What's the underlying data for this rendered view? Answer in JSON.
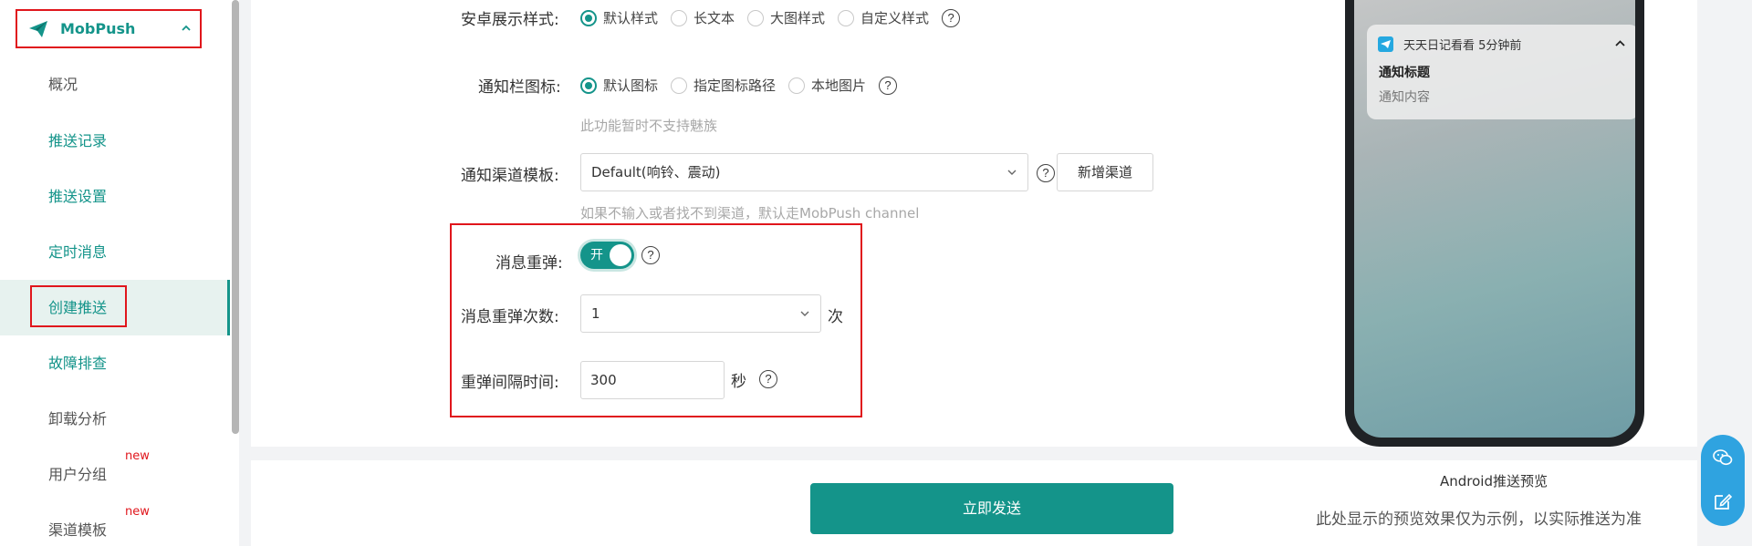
{
  "sidebar": {
    "brand": "MobPush",
    "items": [
      {
        "label": "概况",
        "badge": ""
      },
      {
        "label": "推送记录",
        "badge": ""
      },
      {
        "label": "推送设置",
        "badge": ""
      },
      {
        "label": "定时消息",
        "badge": ""
      },
      {
        "label": "创建推送",
        "badge": ""
      },
      {
        "label": "故障排查",
        "badge": ""
      },
      {
        "label": "卸载分析",
        "badge": ""
      },
      {
        "label": "用户分组",
        "badge": "new"
      },
      {
        "label": "渠道模板",
        "badge": "new"
      }
    ]
  },
  "form": {
    "display_style": {
      "label": "安卓展示样式:",
      "options": [
        "默认样式",
        "长文本",
        "大图样式",
        "自定义样式"
      ],
      "selected": "默认样式"
    },
    "notify_icon": {
      "label": "通知栏图标:",
      "options": [
        "默认图标",
        "指定图标路径",
        "本地图片"
      ],
      "selected": "默认图标",
      "hint": "此功能暂时不支持魅族"
    },
    "channel_template": {
      "label": "通知渠道模板:",
      "value": "Default(响铃、震动)",
      "add_button": "新增渠道",
      "hint": "如果不输入或者找不到渠道，默认走MobPush channel"
    },
    "repop": {
      "label": "消息重弹:",
      "toggle_text": "开",
      "enabled": true
    },
    "repop_count": {
      "label": "消息重弹次数:",
      "value": "1",
      "unit": "次"
    },
    "repop_interval": {
      "label": "重弹间隔时间:",
      "value": "300",
      "unit": "秒"
    },
    "help_glyph": "?"
  },
  "actions": {
    "send_label": "立即发送"
  },
  "preview": {
    "app_line": "天天日记看看 5分钟前",
    "title": "通知标题",
    "content": "通知内容",
    "label": "Android推送预览",
    "note": "此处显示的预览效果仅为示例，以实际推送为准"
  },
  "colors": {
    "accent": "#14948a",
    "highlight_border": "#e0161c",
    "float_button": "#2fa3e0"
  }
}
